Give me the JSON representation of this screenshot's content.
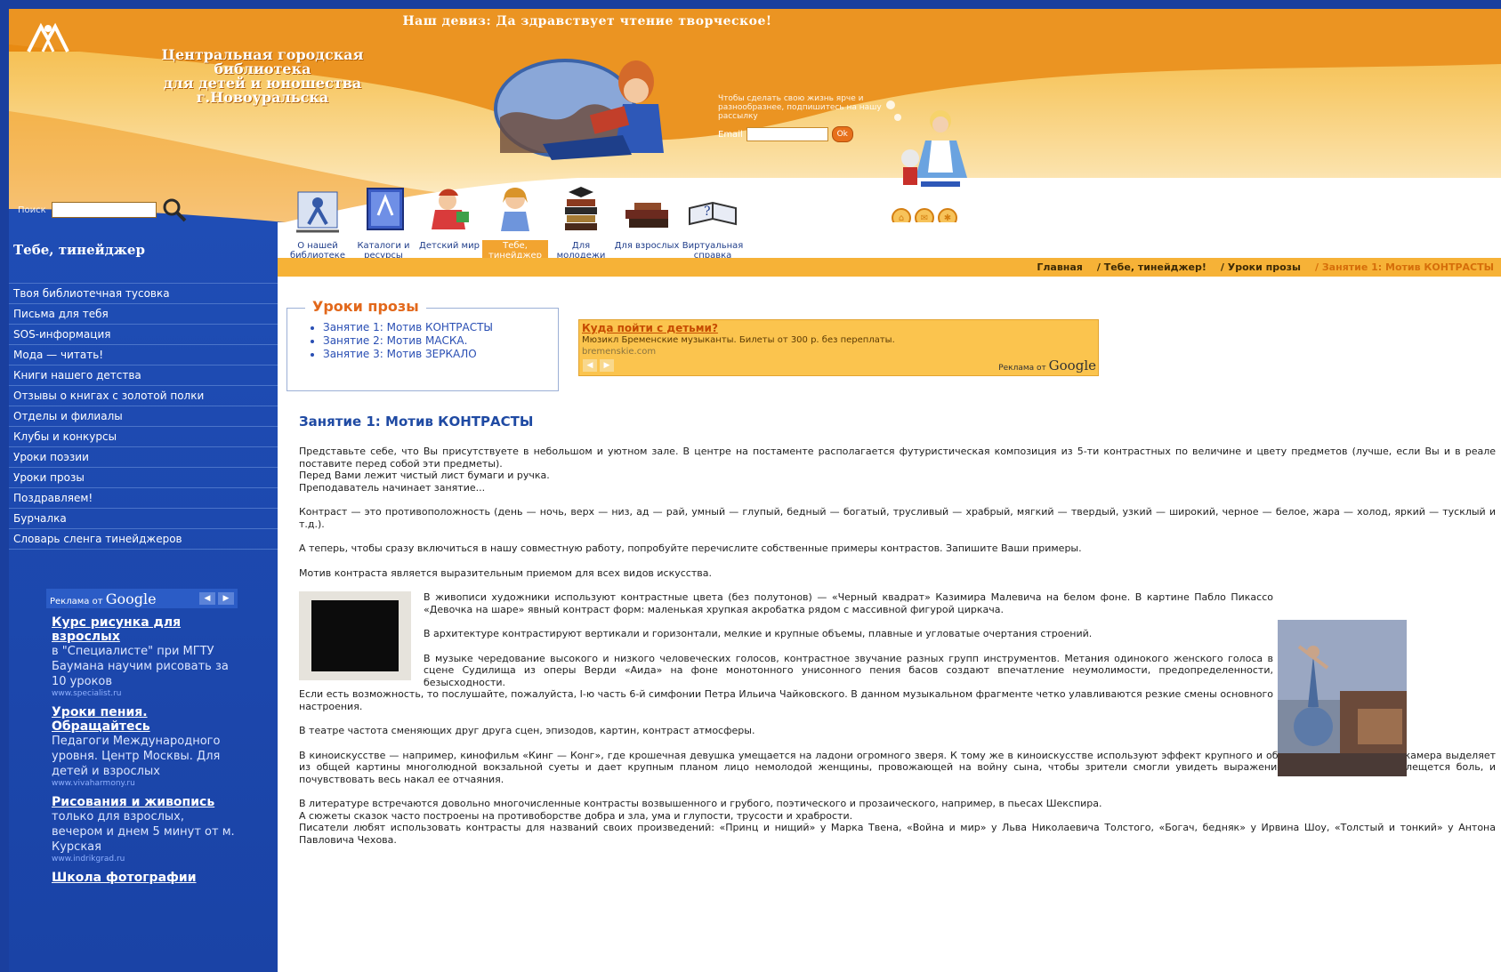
{
  "header": {
    "motto": "Наш девиз: Да здравствует чтение творческое!",
    "library_name": [
      "Центральная городская",
      "библиотека",
      "для детей и юношества",
      "г.Новоуральска"
    ],
    "subscribe_text": "Чтобы сделать свою жизнь ярче и разнообразнее, подпишитесь на нашу рассылку",
    "email_label": "Email",
    "go_label": "Ok",
    "search_label": "Поиск"
  },
  "nav": {
    "items": [
      {
        "label": "О нашей библиотеке"
      },
      {
        "label": "Каталоги и ресурсы"
      },
      {
        "label": "Детский мир"
      },
      {
        "label": "Тебе, тинейджер"
      },
      {
        "label": "Для молодежи"
      },
      {
        "label": "Для взрослых"
      },
      {
        "label": "Виртуальная справка"
      }
    ]
  },
  "breadcrumb": [
    "Главная",
    "/ Тебе, тинейджер!",
    "/ Уроки прозы",
    "/ Занятие 1: Мотив КОНТРАСТЫ"
  ],
  "sidebar": {
    "title": "Тебе, тинейджер",
    "items": [
      "Твоя библиотечная тусовка",
      "Письма для тебя",
      "SOS-информация",
      "Мода — читать!",
      "Книги нашего детства",
      "Отзывы о книгах с золотой полки",
      "Отделы и филиалы",
      "Клубы и конкурсы",
      "Уроки поэзии",
      "Уроки прозы",
      "Поздравляем!",
      "Бурчалка",
      "Словарь сленга тинейджеров"
    ],
    "ads_by": "Реклама от",
    "ads_brand": "Google",
    "ads": [
      {
        "title": "Курс рисунка для взрослых",
        "desc": "в \"Специалисте\" при МГТУ Баумана научим рисовать за 10 уроков",
        "url": "www.specialist.ru"
      },
      {
        "title": "Уроки пения. Обращайтесь",
        "desc": "Педагоги Международного уровня. Центр Москвы. Для детей и взрослых",
        "url": "www.vivaharmony.ru"
      },
      {
        "title": "Рисования и живопись",
        "desc": "только для взрослых, вечером и днем 5 минут от м. Курская",
        "url": "www.indrikgrad.ru"
      },
      {
        "title": "Школа фотографии",
        "desc": "",
        "url": ""
      }
    ]
  },
  "lessons": {
    "title": "Уроки прозы",
    "items": [
      "Занятие 1: Мотив КОНТРАСТЫ",
      "Занятие 2: Мотив МАСКА.",
      "Занятие 3: Мотив ЗЕРКАЛО"
    ]
  },
  "ad_banner": {
    "title": "Куда пойти с детьми?",
    "desc": "Мюзикл Бременские музыканты. Билеты от 300 р. без переплаты.",
    "url": "bremenskie.com",
    "by": "Реклама от",
    "brand": "Google"
  },
  "article": {
    "title": "Занятие 1: Мотив КОНТРАСТЫ",
    "p1": "Представьте себе, что Вы присутствуете в небольшом и уютном зале. В центре на постаменте располагается футуристическая композиция из 5-ти контрастных по величине и цвету предметов (лучше, если Вы и в реале поставите перед собой эти предметы).",
    "p1b": "Перед Вами лежит чистый лист бумаги и ручка.",
    "p1c": "Преподаватель начинает занятие...",
    "p2": "Контраст — это противоположность (день — ночь, верх — низ, ад — рай, умный — глупый, бедный — богатый, трусливый — храбрый, мягкий — твердый, узкий — широкий, черное — белое, жара — холод, яркий — тусклый и т.д.).",
    "p3": "А теперь, чтобы сразу включиться в нашу совместную работу, попробуйте перечислите собственные примеры контрастов. Запишите Ваши примеры.",
    "p4": "Мотив контраста является выразительным приемом для всех видов искусства.",
    "p5": "В живописи художники используют контрастные цвета (без полутонов) — «Черный квадрат» Казимира Малевича на белом фоне. В картине Пабло Пикассо «Девочка на шаре» явный контраст форм: маленькая хрупкая акробатка рядом с массивной фигурой циркача.",
    "p6": "В архитектуре контрастируют вертикали и горизонтали, мелкие и крупные объемы, плавные и угловатые очертания строений.",
    "p7": "В музыке чередование высокого и низкого человеческих голосов, контрастное звучание разных групп инструментов. Метания одинокого женского голоса в сцене Судилища из оперы Верди «Аида» на фоне монотонного унисонного пения басов создают впечатление неумолимости, предопределенности, безысходности.",
    "p7b": "Если есть возможность, то послушайте, пожалуйста, I-ю часть 6-й симфонии Петра Ильича Чайковского. В данном музыкальном фрагменте четко улавливаются резкие смены основного настроения.",
    "p8": "В театре частота сменяющих друг друга сцен, эпизодов, картин, контраст атмосферы.",
    "p9": "В киноискусстве — например, кинофильм «Кинг — Конг», где крошечная девушка умещается на ладони огромного зверя. К тому же в киноискусстве используют эффект крупного и общего плана. Например, камера выделяет из общей картины многолюдной вокзальной суеты и дает крупным планом лицо немолодой женщины, провожающей на войну сына, чтобы зрители смогли увидеть выражение ее глаз, в которых плещется боль, и почувствовать весь накал ее отчаяния.",
    "p10": "В литературе встречаются довольно многочисленные контрасты возвышенного и грубого, поэтического и прозаического, например, в пьесах Шекспира.",
    "p10b": "А сюжеты сказок часто построены на противоборстве добра и зла, ума и глупости, трусости и храбрости.",
    "p10c": "Писатели любят использовать контрасты для названий своих произведений: «Принц и нищий» у Марка Твена, «Война и мир» у Льва Николаевича Толстого, «Богач, бедняк» у Ирвина Шоу, «Толстый и тонкий» у Антона Павловича Чехова."
  },
  "colors": {
    "page_bg": "#1a3f9e",
    "header_orange": "#f4a72b",
    "sidebar_blue": "#1f4db5",
    "accent": "#e2681b"
  }
}
